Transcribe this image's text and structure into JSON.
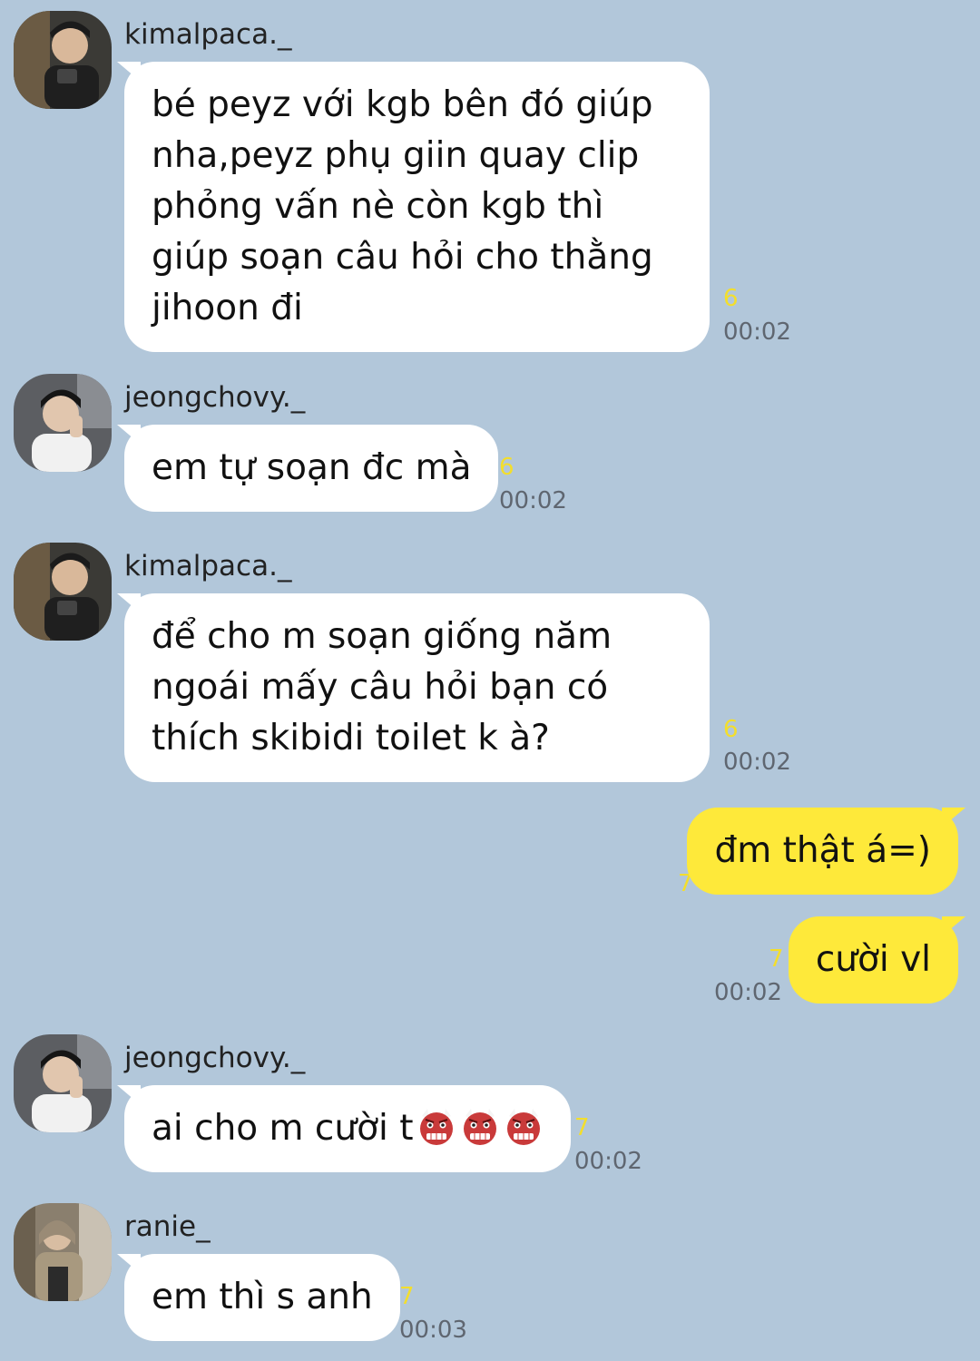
{
  "messages": [
    {
      "sender": "kimalpaca._",
      "text": "bé peyz với kgb bên đó giúp nha,peyz phụ giin quay clip phỏng vấn nè còn kgb thì giúp soạn câu hỏi cho thằng jihoon đi",
      "read_count": "6",
      "time": "00:02"
    },
    {
      "sender": "jeongchovy._",
      "text": "em tự soạn đc mà",
      "read_count": "6",
      "time": "00:02"
    },
    {
      "sender": "kimalpaca._",
      "text": "để cho m soạn giống năm ngoái mấy câu hỏi bạn có thích skibidi toilet k à?",
      "read_count": "6",
      "time": "00:02"
    },
    {
      "text": "đm thật á=)",
      "read_count": "7"
    },
    {
      "text": "cười vl",
      "read_count": "7",
      "time": "00:02"
    },
    {
      "sender": "jeongchovy._",
      "text": "ai cho m cười t",
      "emoji": "ogre-emoji",
      "emoji_count": 3,
      "read_count": "7",
      "time": "00:02"
    },
    {
      "sender": "ranie_",
      "text": "em thì s anh",
      "read_count": "7",
      "time": "00:03"
    }
  ],
  "colors": {
    "background": "#b2c7da",
    "incoming_bubble": "#ffffff",
    "outgoing_bubble": "#fee93a",
    "read_count": "#f3de2c",
    "timestamp": "#5f6670"
  }
}
